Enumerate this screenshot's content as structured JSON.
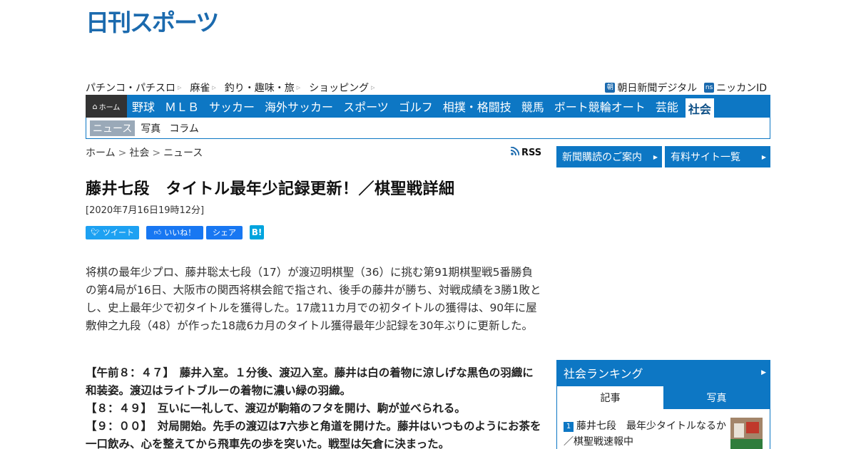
{
  "logo": {
    "text": "日刊スポーツ",
    "color": "#1b6aae"
  },
  "subnav": {
    "left": [
      "パチンコ・パチスロ",
      "麻雀",
      "釣り・趣味・旅",
      "ショッピング"
    ],
    "right": [
      {
        "badge": "朝",
        "label": "朝日新聞デジタル"
      },
      {
        "badge": "ns",
        "label": "ニッカンID"
      }
    ]
  },
  "mainnav": {
    "home_label": "ホーム",
    "items": [
      "野球",
      "ＭＬＢ",
      "サッカー",
      "海外サッカー",
      "スポーツ",
      "ゴルフ",
      "相撲・格闘技",
      "競馬",
      "ボート競輪オート",
      "芸能"
    ],
    "active": "社会",
    "accent": "#0d77c4"
  },
  "catnav": {
    "active": "ニュース",
    "items": [
      "写真",
      "コラム"
    ]
  },
  "breadcrumb": [
    "ホーム",
    "社会",
    "ニュース"
  ],
  "rss_label": "RSS",
  "article": {
    "title": "藤井七段　タイトル最年少記録更新！／棋聖戦詳細",
    "date": "[2020年7月16日19時12分]",
    "share": {
      "tweet": "ツイート",
      "like": "いいね！",
      "fb_share": "シェア",
      "hatena": "B!"
    },
    "lead": "将棋の最年少プロ、藤井聡太七段（17）が渡辺明棋聖（36）に挑む第91期棋聖戦5番勝負の第4局が16日、大阪市の関西将棋会館で指され、後手の藤井が勝ち、対戦成績を3勝1敗とし、史上最年少で初タイトルを獲得した。17歳11カ月での初タイトルの獲得は、90年に屋敷伸之九段（48）が作った18歳6カ月のタイトル獲得最年少記録を30年ぶりに更新した。",
    "live": [
      "【午前８：４７】　藤井入室。１分後、渡辺入室。藤井は白の着物に涼しげな黒色の羽織に和装姿。渡辺はライトブルーの着物に濃い緑の羽織。",
      "【８：４９】　互いに一礼して、渡辺が駒箱のフタを開け、駒が並べられる。",
      "【９：００】　対局開始。先手の渡辺は7六歩と角道を開けた。藤井はいつものようにお茶を一口飲み、心を整えてから飛車先の歩を突いた。戦型は矢倉に決まった。"
    ]
  },
  "sidebar": {
    "buttons": [
      "新聞購読のご案内",
      "有料サイト一覧"
    ],
    "ranking": {
      "title": "社会ランキング",
      "tabs": [
        "記事",
        "写真"
      ],
      "items": [
        {
          "rank": "1",
          "text": "藤井七段　最年少タイトルなるか／棋聖戦速報中"
        }
      ]
    }
  }
}
